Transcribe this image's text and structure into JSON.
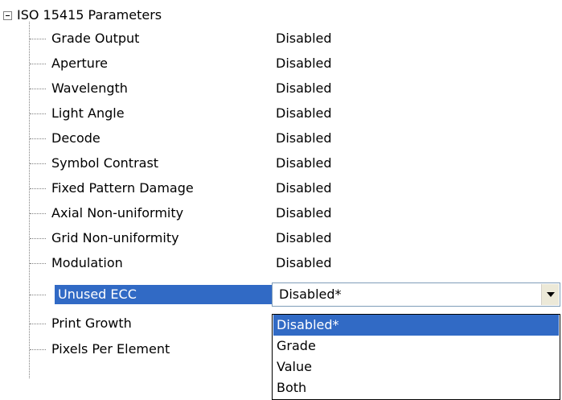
{
  "tree": {
    "root_label": "ISO 15415 Parameters",
    "rows": [
      {
        "name": "Grade Output",
        "value": "Disabled"
      },
      {
        "name": "Aperture",
        "value": "Disabled"
      },
      {
        "name": "Wavelength",
        "value": "Disabled"
      },
      {
        "name": "Light Angle",
        "value": "Disabled"
      },
      {
        "name": "Decode",
        "value": "Disabled"
      },
      {
        "name": "Symbol Contrast",
        "value": "Disabled"
      },
      {
        "name": "Fixed Pattern Damage",
        "value": "Disabled"
      },
      {
        "name": "Axial Non-uniformity",
        "value": "Disabled"
      },
      {
        "name": "Grid Non-uniformity",
        "value": "Disabled"
      },
      {
        "name": "Modulation",
        "value": "Disabled"
      },
      {
        "name": "Unused ECC",
        "value": "Disabled*"
      },
      {
        "name": "Print Growth",
        "value": ""
      },
      {
        "name": "Pixels Per Element",
        "value": ""
      }
    ]
  },
  "combo": {
    "value": "Disabled*",
    "options": [
      "Disabled*",
      "Grade",
      "Value",
      "Both"
    ],
    "selected_option": "Disabled*"
  },
  "colors": {
    "selection": "#316ac5",
    "selection_text": "#ffffff",
    "tree_line": "#808080"
  },
  "icons": {
    "expander": "minus-box-icon",
    "combo_button": "chevron-down-icon"
  }
}
